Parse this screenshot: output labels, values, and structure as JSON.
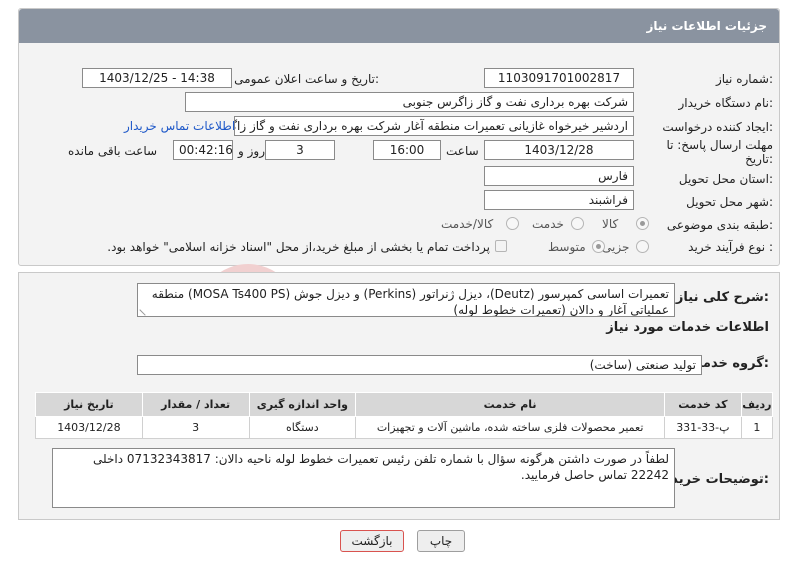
{
  "header": {
    "title": "جزئیات اطلاعات نیاز"
  },
  "fields": {
    "need_number_label": "شماره نیاز:",
    "need_number": "1103091701002817",
    "announce_label": "تاریخ و ساعت اعلان عمومی:",
    "announce_value": "1403/12/25 - 14:38",
    "buyer_org_label": "نام دستگاه خریدار:",
    "buyer_org": "شرکت بهره برداری نفت و گاز زاگرس جنوبی",
    "creator_label": "ایجاد کننده درخواست:",
    "creator": "اردشیر خیرخواه غازیانی تعمیرات منطقه آغار شرکت بهره برداری نفت و گاز زاگرس",
    "buyer_contact_link": "اطلاعات تماس خریدار",
    "deadline_label_1": "مهلت ارسال پاسخ: تا",
    "deadline_label_2": "تاریخ:",
    "deadline_date": "1403/12/28",
    "time_label": "ساعت",
    "deadline_time": "16:00",
    "days_value": "3",
    "days_label": "روز و",
    "remaining_time": "00:42:16",
    "remaining_label": "ساعت باقی مانده",
    "province_label": "استان محل تحویل:",
    "province": "فارس",
    "city_label": "شهر محل تحویل:",
    "city": "فراشبند",
    "category_label": "طبقه بندی موضوعی:",
    "category_options": [
      "کالا",
      "خدمت",
      "کالا/خدمت"
    ],
    "process_label": "نوع فرآیند خرید :",
    "process_options": [
      "جزیی",
      "متوسط"
    ],
    "payment_note": "پرداخت تمام یا بخشی از مبلغ خرید،از محل \"اسناد خزانه اسلامی\" خواهد بود."
  },
  "description": {
    "label": "شرح کلی نیاز:",
    "text": "تعمیرات اساسی کمپرسور (Deutz)، دیزل ژنراتور (Perkins) و دیزل جوش (MOSA Ts400 PS) منطقه عملیاتی آغار و دالان (تعمیرات خطوط لوله)"
  },
  "services": {
    "section_title": "اطلاعات خدمات مورد نیاز",
    "group_label": "گروه خدمت:",
    "group_value": "تولید صنعتی (ساخت)",
    "columns": [
      "ردیف",
      "کد خدمت",
      "نام خدمت",
      "واحد اندازه گیری",
      "تعداد / مقدار",
      "تاریخ نیاز"
    ],
    "rows": [
      [
        "1",
        "پ-33-331",
        "تعمیر محصولات فلزی ساخته شده، ماشین آلات و تجهیزات",
        "دستگاه",
        "3",
        "1403/12/28"
      ]
    ]
  },
  "buyer_notes": {
    "label": "توضیحات خریدار:",
    "text": "لطفاً در صورت داشتن هرگونه سؤال با شماره تلفن رئیس تعمیرات خطوط لوله ناحیه دالان: 07132343817 داخلی 22242 تماس حاصل فرمایید."
  },
  "buttons": {
    "print": "چاپ",
    "back": "بازگشت"
  },
  "colors": {
    "header_bg": "#8a93a0",
    "link": "#1e58c8",
    "back_button_border": "#d9534f"
  }
}
